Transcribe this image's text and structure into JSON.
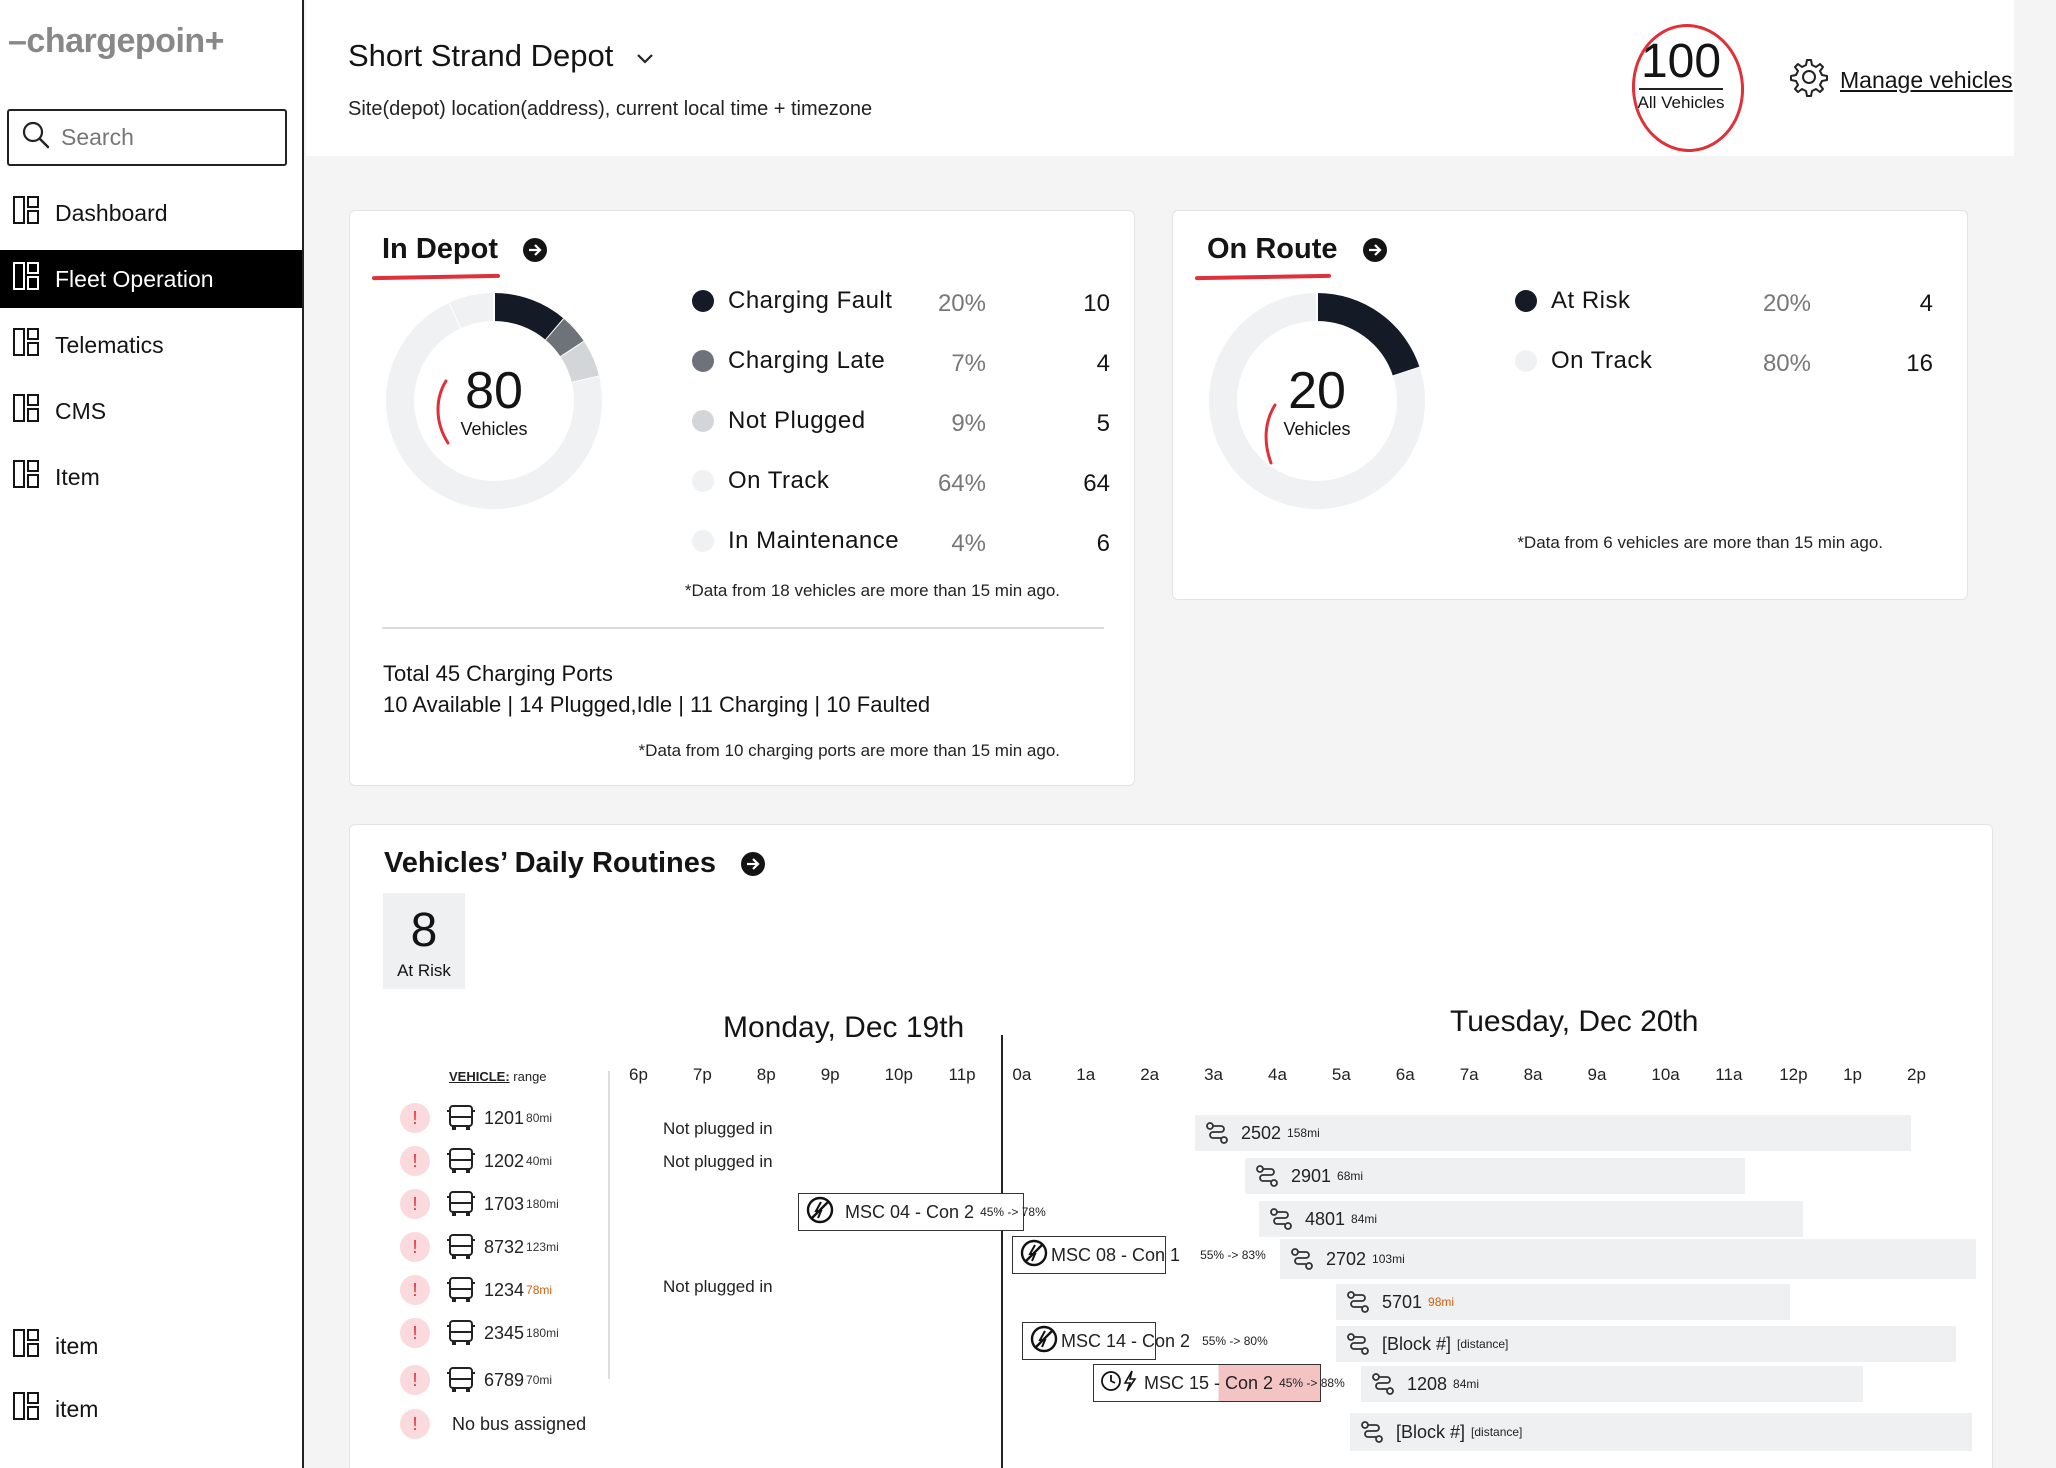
{
  "sidebar": {
    "logo": "chargepoin",
    "search_placeholder": "Search",
    "items": [
      {
        "label": "Dashboard"
      },
      {
        "label": "Fleet Operation"
      },
      {
        "label": "Telematics"
      },
      {
        "label": "CMS"
      },
      {
        "label": "Item"
      }
    ],
    "bottom_items": [
      {
        "label": "item"
      },
      {
        "label": "item"
      }
    ]
  },
  "header": {
    "site_title": "Short Strand Depot",
    "site_subtitle": "Site(depot) location(address), current local time + timezone",
    "all_vehicles_count": "100",
    "all_vehicles_label": "All Vehicles",
    "manage_label": "Manage vehicles"
  },
  "in_depot": {
    "title": "In Depot",
    "total": "80",
    "total_label": "Vehicles",
    "legend": [
      {
        "name": "Charging Fault",
        "pct": "20%",
        "count": "10",
        "color": "#141a26",
        "value": 10
      },
      {
        "name": "Charging Late",
        "pct": "7%",
        "count": "4",
        "color": "#6e737a",
        "value": 4
      },
      {
        "name": "Not Plugged",
        "pct": "9%",
        "count": "5",
        "color": "#d3d6d9",
        "value": 5
      },
      {
        "name": "On Track",
        "pct": "64%",
        "count": "64",
        "color": "#eff1f2",
        "value": 64
      },
      {
        "name": "In Maintenance",
        "pct": "4%",
        "count": "6",
        "color": "#eff1f2",
        "value": 6
      }
    ],
    "note": "*Data from 18 vehicles are more than 15 min ago.",
    "ports_total": "Total 45 Charging Ports",
    "ports_detail": "10 Available | 14 Plugged,Idle | 11 Charging | 10 Faulted",
    "ports_note": "*Data from 10 charging ports are more than 15 min ago."
  },
  "on_route": {
    "title": "On Route",
    "total": "20",
    "total_label": "Vehicles",
    "legend": [
      {
        "name": "At Risk",
        "pct": "20%",
        "count": "4",
        "color": "#141a26",
        "value": 4
      },
      {
        "name": "On Track",
        "pct": "80%",
        "count": "16",
        "color": "#eff1f2",
        "value": 16
      }
    ],
    "note": "*Data from 6 vehicles are more than 15 min ago."
  },
  "routines": {
    "title": "Vehicles’ Daily Routines",
    "at_risk_count": "8",
    "at_risk_label": "At Risk",
    "day1": "Monday, Dec 19th",
    "day2": "Tuesday, Dec 20th",
    "vehicle_header_bold": "VEHICLE:",
    "vehicle_header_rest": " range",
    "hours": [
      "6p",
      "7p",
      "8p",
      "9p",
      "10p",
      "11p",
      "0a",
      "1a",
      "2a",
      "3a",
      "4a",
      "5a",
      "6a",
      "7a",
      "8a",
      "9a",
      "10a",
      "11a",
      "12p",
      "1p",
      "2p"
    ],
    "warn_symbol": "!",
    "vehicles": [
      {
        "id": "1201",
        "range": "80mi",
        "low": false
      },
      {
        "id": "1202",
        "range": "40mi",
        "low": false
      },
      {
        "id": "1703",
        "range": "180mi",
        "low": false
      },
      {
        "id": "8732",
        "range": "123mi",
        "low": false
      },
      {
        "id": "1234",
        "range": "78mi",
        "low": true
      },
      {
        "id": "2345",
        "range": "180mi",
        "low": false
      },
      {
        "id": "6789",
        "range": "70mi",
        "low": false
      }
    ],
    "no_bus_label": "No bus assigned",
    "not_plugged": "Not plugged in",
    "charging": [
      {
        "label": "MSC 04 - Con 2",
        "pct": "45% -> 78%"
      },
      {
        "label": "MSC 08 - Con 1",
        "pct": "55% -> 83%"
      },
      {
        "label": "MSC 14 - Con 2",
        "pct": "55% -> 80%"
      },
      {
        "label": "MSC 15 - Con 2",
        "pct": "45% -> 88%"
      }
    ],
    "routes": [
      {
        "label": "2502",
        "range": "158mi",
        "low": false
      },
      {
        "label": "2901",
        "range": "68mi",
        "low": false
      },
      {
        "label": "4801",
        "range": "84mi",
        "low": false
      },
      {
        "label": "2702",
        "range": "103mi",
        "low": false
      },
      {
        "label": "5701",
        "range": "98mi",
        "low": true
      },
      {
        "label": "[Block #]",
        "range": "[distance]",
        "low": false
      },
      {
        "label": "1208",
        "range": "84mi",
        "low": false
      },
      {
        "label": "[Block #]",
        "range": "[distance]",
        "low": false
      }
    ]
  }
}
